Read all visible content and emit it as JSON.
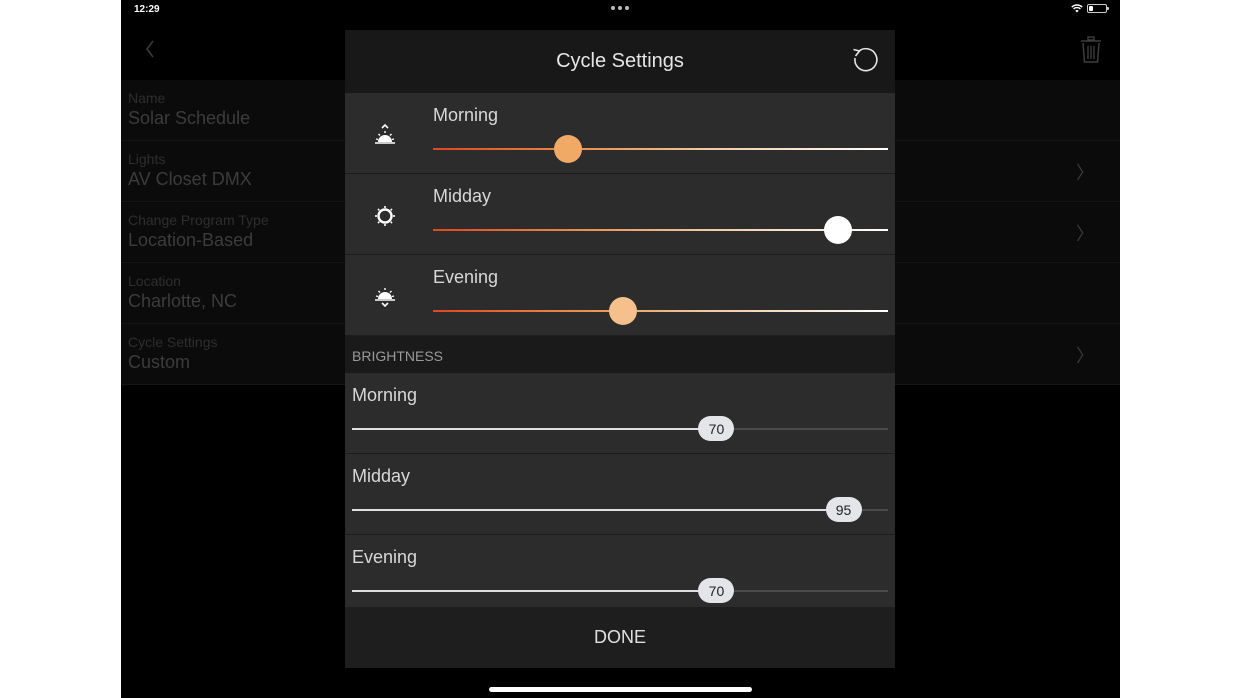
{
  "status_bar": {
    "time": "12:29",
    "battery_level": 0.25
  },
  "background": {
    "back_icon": "chevron-left-icon",
    "trash_icon": "trash-icon",
    "rows": [
      {
        "label": "Name",
        "value": "Solar Schedule",
        "chevron": false
      },
      {
        "label": "Lights",
        "value": "AV Closet DMX",
        "chevron": true
      },
      {
        "label": "Change Program Type",
        "value": "Location-Based",
        "chevron": true
      },
      {
        "label": "Location",
        "value": "Charlotte, NC",
        "chevron": false
      },
      {
        "label": "Cycle Settings",
        "value": "Custom",
        "chevron": true
      }
    ],
    "chevron_glyph": "〉"
  },
  "modal": {
    "title": "Cycle Settings",
    "reset_icon": "reset-icon",
    "cycle": [
      {
        "label": "Morning",
        "icon": "sunrise-icon",
        "value": 0.297,
        "thumb_color": "#f0aa66"
      },
      {
        "label": "Midday",
        "icon": "sun-icon",
        "value": 0.89,
        "thumb_color": "#ffffff"
      },
      {
        "label": "Evening",
        "icon": "sunset-icon",
        "value": 0.418,
        "thumb_color": "#f5c08c"
      }
    ],
    "brightness_header": "BRIGHTNESS",
    "brightness": [
      {
        "label": "Morning",
        "value": 70,
        "display": "70"
      },
      {
        "label": "Midday",
        "value": 95,
        "display": "95"
      },
      {
        "label": "Evening",
        "value": 70,
        "display": "70"
      }
    ],
    "brightness_max": 100,
    "done_label": "DONE"
  }
}
